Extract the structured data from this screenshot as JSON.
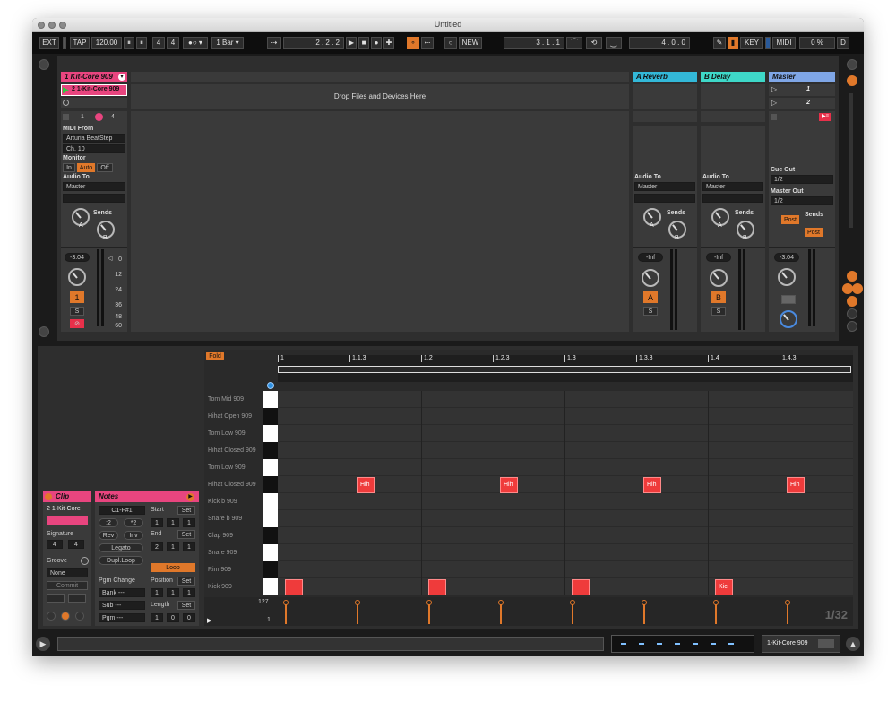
{
  "window": {
    "title": "Untitled"
  },
  "transport": {
    "ext": "EXT",
    "tap": "TAP",
    "tempo": "120.00",
    "sig_num": "4",
    "sig_den": "4",
    "metro_icon": "metronome-icon",
    "quant": "1 Bar",
    "arrangement_pos": "2 .   2 .   2",
    "new": "NEW",
    "loop_start": "3 .   1 .   1",
    "loop_len": "4 .   0 .   0",
    "key": "KEY",
    "midi": "MIDI",
    "cpu": "0 %",
    "d": "D"
  },
  "session": {
    "track1": {
      "name": "1 Kit-Core 909",
      "clip": "2 1-Kit-Core 909",
      "color": "#e8457f",
      "num1": "1",
      "num2": "4",
      "midi_from_label": "MIDI From",
      "midi_from": "Arturia BeatStep",
      "channel": "Ch. 10",
      "monitor_label": "Monitor",
      "monitor_in": "In",
      "monitor_auto": "Auto",
      "monitor_off": "Off",
      "audio_to_label": "Audio To",
      "audio_to": "Master",
      "sends_label": "Sends",
      "send_a": "A",
      "send_b": "B",
      "volume": "-3.04",
      "track_num": "1",
      "solo": "S"
    },
    "drop_text": "Drop Files and Devices Here",
    "return_a": {
      "name": "A Reverb",
      "color": "#33b8d8",
      "audio_to_label": "Audio To",
      "audio_to": "Master",
      "sends_label": "Sends",
      "send_a": "A",
      "send_b": "B",
      "volume": "-Inf",
      "track_btn": "A",
      "solo": "S"
    },
    "return_b": {
      "name": "B Delay",
      "color": "#3ed8c8",
      "audio_to_label": "Audio To",
      "audio_to": "Master",
      "sends_label": "Sends",
      "send_a": "A",
      "send_b": "B",
      "volume": "-Inf",
      "track_btn": "B",
      "solo": "S"
    },
    "master": {
      "name": "Master",
      "color": "#7fa6e6",
      "scene1": "1",
      "scene2": "2",
      "cue_out_label": "Cue Out",
      "cue_out": "1/2",
      "master_out_label": "Master Out",
      "master_out": "1/2",
      "sends_label": "Sends",
      "post1": "Post",
      "post2": "Post",
      "volume": "-3.04"
    },
    "meter_scale": [
      "0",
      "12",
      "24",
      "36",
      "48",
      "60"
    ]
  },
  "clip_view": {
    "clip_title": "Clip",
    "clip_name": "2 1-Kit-Core",
    "signature_label": "Signature",
    "sig_num": "4",
    "sig_den": "4",
    "groove_label": "Groove",
    "groove": "None",
    "commit": "Commit",
    "notes_title": "Notes",
    "note_range": "C1-F#1",
    "half": ":2",
    "double": "*2",
    "rev": "Rev",
    "inv": "Inv",
    "legato": "Legato",
    "dupl_loop": "Dupl.Loop",
    "start_label": "Start",
    "set": "Set",
    "start": [
      "1",
      "1",
      "1"
    ],
    "end_label": "End",
    "end": [
      "2",
      "1",
      "1"
    ],
    "loop": "Loop",
    "position_label": "Position",
    "position": [
      "1",
      "1",
      "1"
    ],
    "length_label": "Length",
    "length": [
      "1",
      "0",
      "0"
    ],
    "pgm_change": "Pgm Change",
    "bank": "Bank ---",
    "sub": "Sub ---",
    "pgm": "Pgm ---"
  },
  "editor": {
    "fold": "Fold",
    "ruler": [
      "1",
      "1.1.3",
      "1.2",
      "1.2.3",
      "1.3",
      "1.3.3",
      "1.4",
      "1.4.3"
    ],
    "keys": [
      "Tom Mid 909",
      "Hihat Open 909",
      "Tom Low 909",
      "Hihat Closed 909",
      "Tom Low 909",
      "Hihat Closed 909",
      "Kick b 909",
      "Snare b 909",
      "Clap 909",
      "Snare 909",
      "Rim 909",
      "Kick 909"
    ],
    "hihat_notes": [
      "Hih",
      "Hih",
      "Hih",
      "Hih"
    ],
    "kick_notes": [
      "",
      "",
      "",
      "Kic"
    ],
    "vel_max": "127",
    "vel_min": "1",
    "zoom": "1/32"
  },
  "status": {
    "track": "1-Kit-Core 909"
  }
}
